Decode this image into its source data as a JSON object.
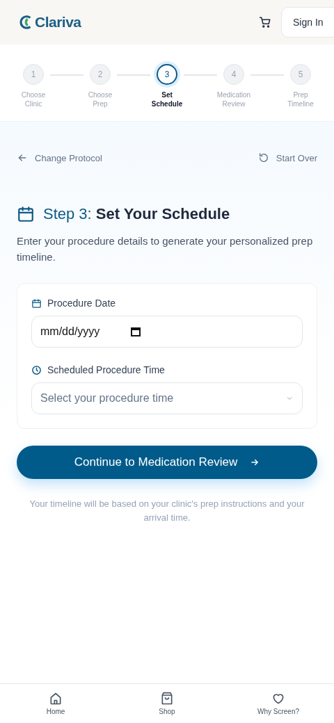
{
  "header": {
    "logo": "Clariva",
    "sign_in": "Sign In"
  },
  "steps": [
    {
      "number": "1",
      "label": "Choose Clinic",
      "selected": false
    },
    {
      "number": "2",
      "label": "Choose Prep",
      "selected": false
    },
    {
      "number": "3",
      "label": "Set Schedule",
      "selected": true
    },
    {
      "number": "4",
      "label": "Medication Review",
      "selected": false
    },
    {
      "number": "5",
      "label": "Prep Timeline",
      "selected": false
    }
  ],
  "nav": {
    "back": "Change Protocol",
    "restart": "Start Over"
  },
  "heading": {
    "step": "Step 3:",
    "title": "Set Your Schedule"
  },
  "intro": "Enter your procedure details to generate your personalized prep timeline.",
  "form": {
    "date_label": "Procedure Date",
    "date_placeholder": "mm/dd/yyyy",
    "time_label": "Scheduled Procedure Time",
    "time_placeholder": "Select your procedure time"
  },
  "continue": "Continue to Medication Review",
  "note": "Your timeline will be based on your clinic's prep instructions and your arrival time.",
  "tabbar": [
    {
      "label": "Home",
      "kind": "home"
    },
    {
      "label": "Shop",
      "kind": "shop"
    },
    {
      "label": "Why Screen?",
      "kind": "heart"
    }
  ]
}
